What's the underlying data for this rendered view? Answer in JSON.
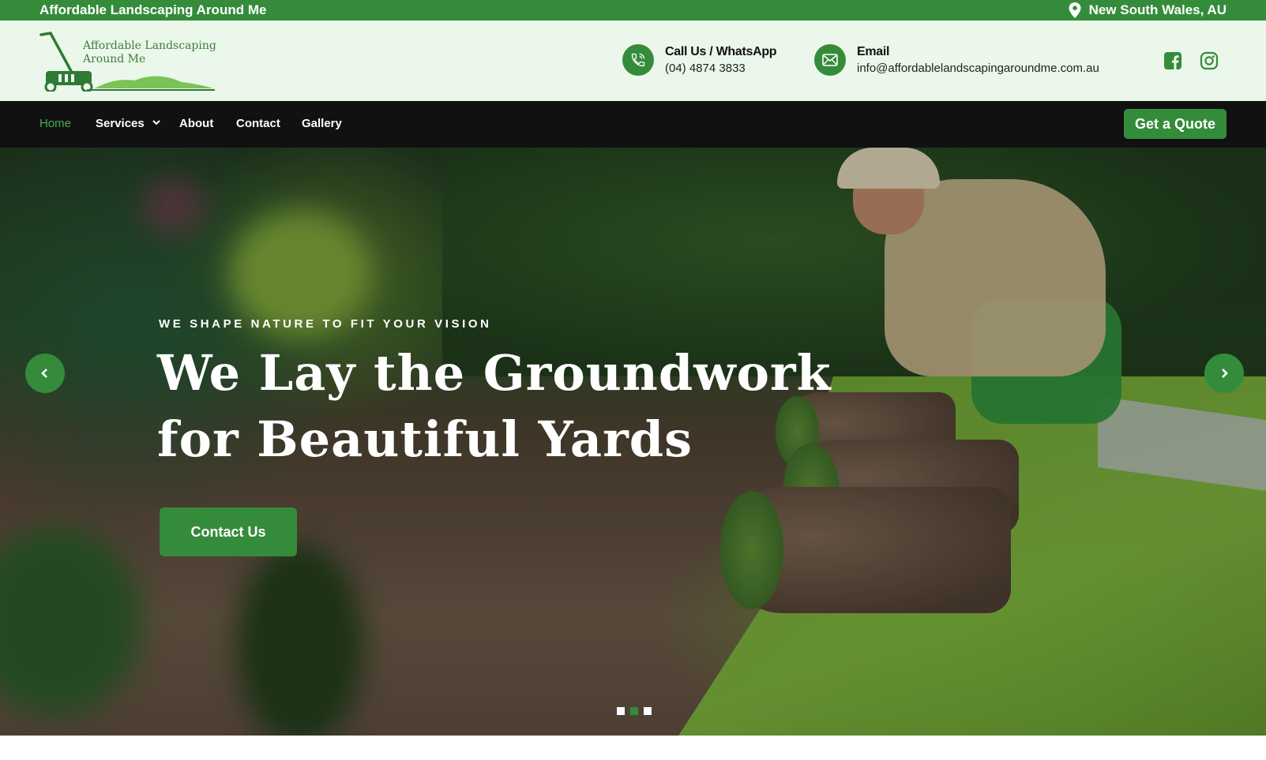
{
  "topbar": {
    "brand": "Affordable Landscaping Around Me",
    "location": "New South Wales, AU"
  },
  "header": {
    "logo_line1": "Affordable Landscaping",
    "logo_line2": "Around Me",
    "phone_title": "Call Us / WhatsApp",
    "phone_value": "(04) 4874 3833",
    "email_title": "Email",
    "email_value": "info@affordablelandscapingaroundme.com.au"
  },
  "nav": {
    "items": [
      "Home",
      "Services",
      "About",
      "Contact",
      "Gallery"
    ],
    "quote_label": "Get a Quote"
  },
  "hero": {
    "eyebrow": "WE SHAPE NATURE TO FIT YOUR VISION",
    "headline_line1": "We Lay the Groundwork",
    "headline_line2": "for Beautiful Yards",
    "cta_label": "Contact Us",
    "slide_count": 3,
    "active_slide": 2
  },
  "colors": {
    "brand_green": "#348c3a",
    "nav_bg": "#111111",
    "header_bg": "#ebf7ea",
    "active_nav": "#43b14c"
  },
  "icons": [
    "location-pin-icon",
    "phone-icon",
    "email-icon",
    "facebook-icon",
    "instagram-icon",
    "chevron-down-icon",
    "chevron-left-icon",
    "chevron-right-icon",
    "lawn-mower-logo"
  ]
}
